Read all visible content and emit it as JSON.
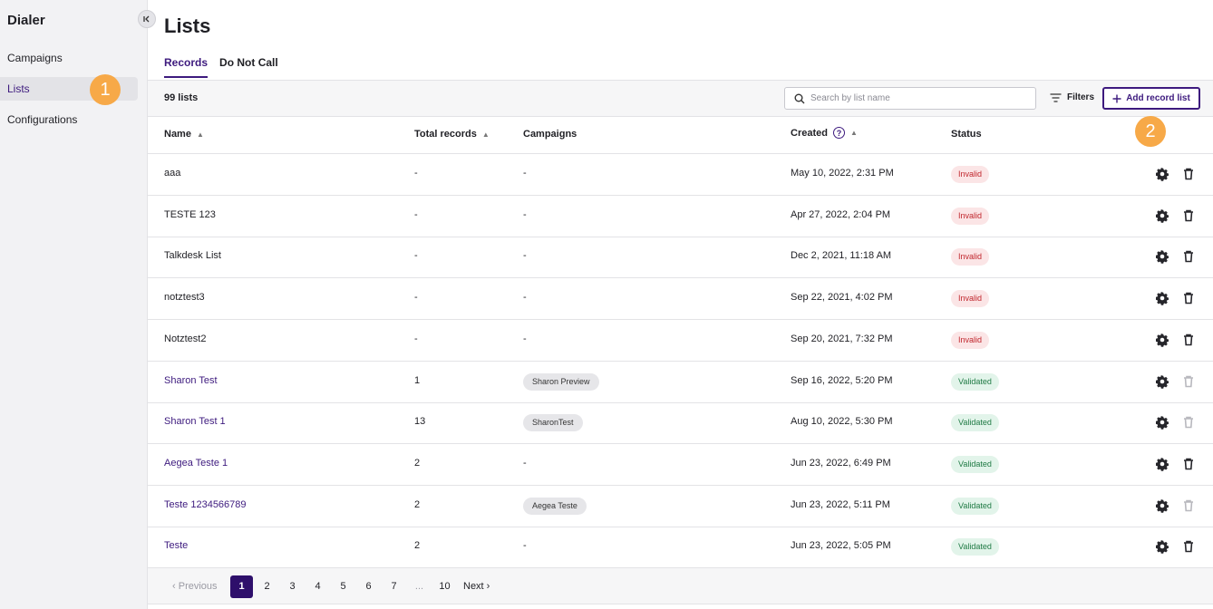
{
  "sidebar": {
    "title": "Dialer",
    "collapse_icon": "chevron-left-bar-icon",
    "items": [
      {
        "label": "Campaigns",
        "active": false
      },
      {
        "label": "Lists",
        "active": true
      },
      {
        "label": "Configurations",
        "active": false
      }
    ]
  },
  "annotations": {
    "marker1": "1",
    "marker2": "2"
  },
  "page": {
    "title": "Lists",
    "tabs": [
      {
        "label": "Records",
        "active": true
      },
      {
        "label": "Do Not Call",
        "active": false
      }
    ]
  },
  "toolbar": {
    "count": "99 lists",
    "search_placeholder": "Search by list name",
    "filters_label": "Filters",
    "add_label": "Add record list"
  },
  "table": {
    "headers": {
      "name": "Name",
      "total": "Total records",
      "campaigns": "Campaigns",
      "created": "Created",
      "status": "Status"
    },
    "rows": [
      {
        "name": "aaa",
        "total": "-",
        "campaign": "-",
        "created": "May 10, 2022, 2:31 PM",
        "status": "Invalid",
        "link": false,
        "trash_enabled": true
      },
      {
        "name": "TESTE 123",
        "total": "-",
        "campaign": "-",
        "created": "Apr 27, 2022, 2:04 PM",
        "status": "Invalid",
        "link": false,
        "trash_enabled": true
      },
      {
        "name": "Talkdesk List",
        "total": "-",
        "campaign": "-",
        "created": "Dec 2, 2021, 11:18 AM",
        "status": "Invalid",
        "link": false,
        "trash_enabled": true
      },
      {
        "name": "notztest3",
        "total": "-",
        "campaign": "-",
        "created": "Sep 22, 2021, 4:02 PM",
        "status": "Invalid",
        "link": false,
        "trash_enabled": true
      },
      {
        "name": "Notztest2",
        "total": "-",
        "campaign": "-",
        "created": "Sep 20, 2021, 7:32 PM",
        "status": "Invalid",
        "link": false,
        "trash_enabled": true
      },
      {
        "name": "Sharon Test",
        "total": "1",
        "campaign": "Sharon Preview",
        "created": "Sep 16, 2022, 5:20 PM",
        "status": "Validated",
        "link": true,
        "trash_enabled": false
      },
      {
        "name": "Sharon Test 1",
        "total": "13",
        "campaign": "SharonTest",
        "created": "Aug 10, 2022, 5:30 PM",
        "status": "Validated",
        "link": true,
        "trash_enabled": false
      },
      {
        "name": "Aegea Teste 1",
        "total": "2",
        "campaign": "-",
        "created": "Jun 23, 2022, 6:49 PM",
        "status": "Validated",
        "link": true,
        "trash_enabled": true
      },
      {
        "name": "Teste 1234566789",
        "total": "2",
        "campaign": "Aegea Teste",
        "created": "Jun 23, 2022, 5:11 PM",
        "status": "Validated",
        "link": true,
        "trash_enabled": false
      },
      {
        "name": "Teste",
        "total": "2",
        "campaign": "-",
        "created": "Jun 23, 2022, 5:05 PM",
        "status": "Validated",
        "link": true,
        "trash_enabled": true
      }
    ]
  },
  "pagination": {
    "previous": "Previous",
    "next": "Next",
    "pages": [
      "1",
      "2",
      "3",
      "4",
      "5",
      "6",
      "7",
      "...",
      "10"
    ],
    "current": "1"
  },
  "colors": {
    "accent": "#3d1a7e",
    "marker": "#f7a948",
    "invalid": "#c0262d",
    "validated": "#1f7a44"
  }
}
